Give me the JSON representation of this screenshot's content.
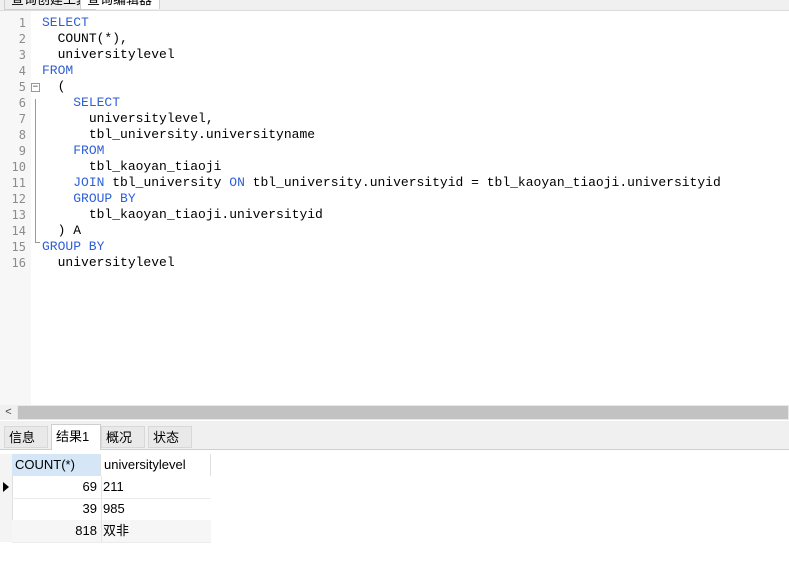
{
  "editor_tabs": [
    {
      "label": "查询创建工具"
    },
    {
      "label": "查询编辑器"
    }
  ],
  "editor": {
    "lines": [
      {
        "num": "1",
        "indent": "",
        "parts": [
          {
            "t": "SELECT",
            "kw": true
          }
        ]
      },
      {
        "num": "2",
        "indent": "  ",
        "parts": [
          {
            "t": "COUNT(*),",
            "kw": false
          }
        ]
      },
      {
        "num": "3",
        "indent": "  ",
        "parts": [
          {
            "t": "universitylevel",
            "kw": false
          }
        ]
      },
      {
        "num": "4",
        "indent": "",
        "parts": [
          {
            "t": "FROM",
            "kw": true
          }
        ]
      },
      {
        "num": "5",
        "indent": "  ",
        "parts": [
          {
            "t": "(",
            "kw": false
          }
        ]
      },
      {
        "num": "6",
        "indent": "    ",
        "parts": [
          {
            "t": "SELECT",
            "kw": true
          }
        ]
      },
      {
        "num": "7",
        "indent": "      ",
        "parts": [
          {
            "t": "universitylevel,",
            "kw": false
          }
        ]
      },
      {
        "num": "8",
        "indent": "      ",
        "parts": [
          {
            "t": "tbl_university.universityname",
            "kw": false
          }
        ]
      },
      {
        "num": "9",
        "indent": "    ",
        "parts": [
          {
            "t": "FROM",
            "kw": true
          }
        ]
      },
      {
        "num": "10",
        "indent": "      ",
        "parts": [
          {
            "t": "tbl_kaoyan_tiaoji",
            "kw": false
          }
        ]
      },
      {
        "num": "11",
        "indent": "    ",
        "parts": [
          {
            "t": "JOIN",
            "kw": true
          },
          {
            "t": " tbl_university ",
            "kw": false
          },
          {
            "t": "ON",
            "kw": true
          },
          {
            "t": " tbl_university.universityid = tbl_kaoyan_tiaoji.universityid",
            "kw": false
          }
        ]
      },
      {
        "num": "12",
        "indent": "    ",
        "parts": [
          {
            "t": "GROUP BY",
            "kw": true
          }
        ]
      },
      {
        "num": "13",
        "indent": "      ",
        "parts": [
          {
            "t": "tbl_kaoyan_tiaoji.universityid",
            "kw": false
          }
        ]
      },
      {
        "num": "14",
        "indent": "  ",
        "parts": [
          {
            "t": ") A",
            "kw": false
          }
        ]
      },
      {
        "num": "15",
        "indent": "",
        "parts": [
          {
            "t": "GROUP BY",
            "kw": true
          }
        ]
      },
      {
        "num": "16",
        "indent": "  ",
        "parts": [
          {
            "t": "universitylevel",
            "kw": false
          }
        ]
      }
    ],
    "fold_symbol": "−",
    "scroll_left_arrow": "<"
  },
  "result_tabs": [
    {
      "label": "信息",
      "active": false
    },
    {
      "label": "结果1",
      "active": true
    },
    {
      "label": "概况",
      "active": false
    },
    {
      "label": "状态",
      "active": false
    }
  ],
  "grid": {
    "columns": [
      "COUNT(*)",
      "universitylevel"
    ],
    "rows": [
      {
        "count": "69",
        "level": "211"
      },
      {
        "count": "39",
        "level": "985"
      },
      {
        "count": "818",
        "level": "双非"
      }
    ],
    "current_row_index": 0
  },
  "colors": {
    "keyword": "#2d5fd7",
    "header_selected": "#d5e6f7"
  }
}
